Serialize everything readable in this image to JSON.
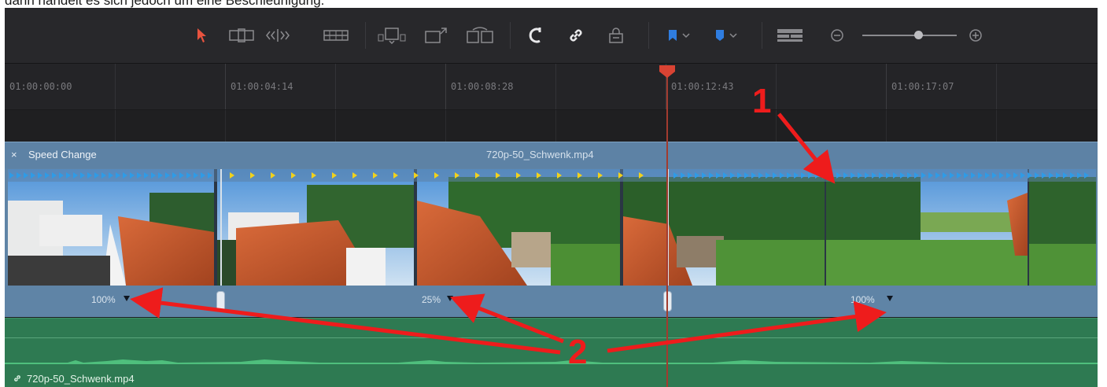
{
  "caption": {
    "text": "dann handelt es sich jedoch um eine Beschleunigung."
  },
  "toolbar": {
    "buttons": [
      {
        "name": "selection-tool-icon",
        "active": true
      },
      {
        "name": "trim-edit-icon"
      },
      {
        "name": "dynamic-trim-icon"
      },
      {
        "name": "blade-edit-icon"
      },
      {
        "name": "insert-clip-icon"
      },
      {
        "name": "overwrite-clip-icon"
      },
      {
        "name": "replace-clip-icon"
      },
      {
        "name": "snapping-magnet-icon"
      },
      {
        "name": "linked-selection-icon"
      },
      {
        "name": "position-lock-icon"
      },
      {
        "name": "flag-dropdown-icon"
      },
      {
        "name": "marker-dropdown-icon"
      },
      {
        "name": "timeline-view-options-icon"
      },
      {
        "name": "zoom-out-icon"
      },
      {
        "name": "zoom-in-icon"
      }
    ],
    "accent": "#e8533f",
    "flag_color": "#2f7de0"
  },
  "ruler": {
    "timecodes": [
      "01:00:00:00",
      "01:00:04:14",
      "01:00:08:28",
      "01:00:12:43",
      "01:00:17:07"
    ]
  },
  "video_clip": {
    "close_glyph": "×",
    "speed_title": "Speed Change",
    "name": "720p-50_Schwenk.mp4",
    "color": "#5f84a6",
    "segments": [
      {
        "speed": "100%"
      },
      {
        "speed": "25%"
      },
      {
        "speed": "100%"
      }
    ]
  },
  "audio_clip": {
    "link_glyph": "🔗",
    "name": "720p-50_Schwenk.mp4",
    "color": "#2e7a52"
  },
  "playhead": {
    "color": "#d94333"
  },
  "annotations": {
    "label_1": "1",
    "label_2": "2",
    "color": "#ee1c1c"
  }
}
